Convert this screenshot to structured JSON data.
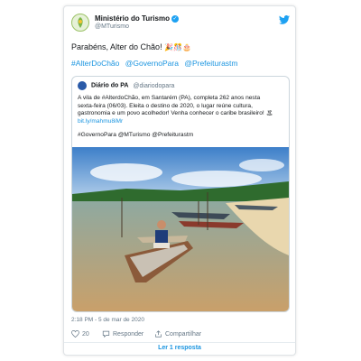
{
  "tweet": {
    "author_name": "Ministério do Turismo",
    "author_handle": "@MTurismo",
    "text": "Parabéns, Alter do Chão!",
    "emojis": "🎉🎊🎂",
    "hashtags": [
      "#AlterDoChão",
      "@GovernoPara",
      "@Prefeiturastm"
    ],
    "timestamp": "2:18 PM - 5 de mar de 2020",
    "actions": {
      "like_count": "20",
      "reply_label": "Responder",
      "share_label": "Compartilhar"
    },
    "replies_link": "Ler 1 resposta"
  },
  "quoted": {
    "author_name": "Diário do PA",
    "author_handle": "@diariodopara",
    "text_lines": [
      "A vila de #AlterdoChão, em Santarém (PA), completa 262 anos nesta",
      "sexta-feira (06/03). Eleita o destino de 2020, o lugar reúne cultura,",
      "gastronomia e um povo acolhedor! Venha conhecer o caribe brasileiro! 🏝",
      "bit.ly/mahmu8iMr"
    ],
    "tags": "#GovernoPara @MTurismo @Prefeiturastm"
  },
  "colors": {
    "accent": "#1da1f2",
    "link": "#1b95e0",
    "muted": "#657786"
  },
  "icons": [
    "ministry-logo-icon",
    "verified-icon",
    "twitter-bird-icon",
    "heart-icon",
    "reply-icon",
    "share-icon"
  ]
}
